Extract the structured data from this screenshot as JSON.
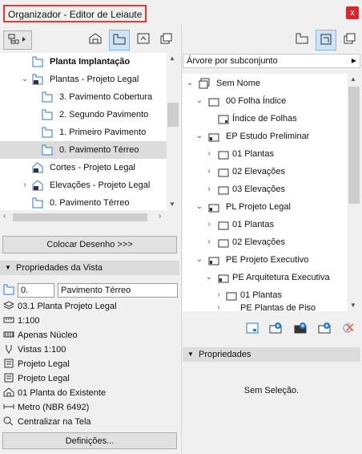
{
  "window": {
    "title": "Organizador - Editor de Leiaute",
    "close_glyph": "x"
  },
  "left_tree": {
    "items": [
      {
        "label": "Planta Implantação",
        "bold": true
      },
      {
        "label": "Plantas - Projeto Legal"
      },
      {
        "label": "3. Pavimento Cobertura"
      },
      {
        "label": "2. Segundo Pavimento"
      },
      {
        "label": "1. Primeiro Pavimento"
      },
      {
        "label": "0. Pavimento Térreo"
      },
      {
        "label": "Cortes - Projeto Legal"
      },
      {
        "label": "Elevações - Projeto Legal"
      },
      {
        "label": "0. Pavimento Térreo"
      }
    ]
  },
  "place_button": "Colocar Desenho >>>",
  "view_props": {
    "header": "Propriedades da Vista",
    "id_value": "0.",
    "name_value": "Pavimento Térreo",
    "rows": [
      "03.1 Planta Projeto Legal",
      "1:100",
      "Apenas Núcleo",
      "Vistas 1:100",
      "Projeto Legal",
      "Projeto Legal",
      "01 Planta do Existente",
      "Metro (NBR 6492)",
      "Centralizar na Tela"
    ],
    "settings_button": "Definições..."
  },
  "right_panel": {
    "dropdown_label": "Árvore por subconjunto",
    "tree": [
      {
        "label": "Sem Nome"
      },
      {
        "label": "00 Folha Índice"
      },
      {
        "label": "Índice de Folhas"
      },
      {
        "label": "EP Estudo Preliminar"
      },
      {
        "label": "01 Plantas"
      },
      {
        "label": "02 Elevações"
      },
      {
        "label": "03 Elevações"
      },
      {
        "label": "PL Projeto Legal"
      },
      {
        "label": "01 Plantas"
      },
      {
        "label": "02 Elevações"
      },
      {
        "label": "PE Projeto Executivo"
      },
      {
        "label": "PE Arquitetura Executiva"
      },
      {
        "label": "01 Plantas"
      },
      {
        "label": "PE Plantas de Piso"
      }
    ],
    "props_header": "Propriedades",
    "no_selection": "Sem Seleção."
  },
  "colors": {
    "accent": "#2a7ad3",
    "close": "#d9262b",
    "highlight_box": "#e53935"
  }
}
